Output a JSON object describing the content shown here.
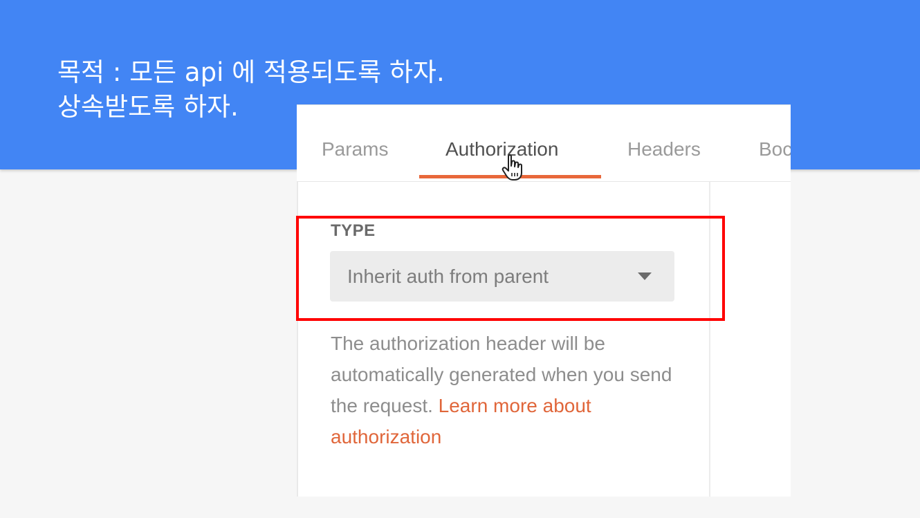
{
  "slide": {
    "title_line1": "목적 : 모든 api 에 적용되도록 하자.",
    "title_line2": "상속받도록 하자.",
    "banner_color": "#4285f4"
  },
  "tabs": [
    {
      "label": "Params",
      "active": false
    },
    {
      "label": "Authorization",
      "active": true
    },
    {
      "label": "Headers",
      "active": false
    },
    {
      "label": "Boc",
      "active": false
    }
  ],
  "auth": {
    "type_label": "TYPE",
    "selected_type": "Inherit auth from parent",
    "description": "The authorization header will be automatically generated when you send the request.",
    "learn_more_link": "Learn more about authorization"
  },
  "colors": {
    "accent": "#e8683a",
    "highlight": "#ff0000"
  },
  "icons": {
    "cursor": "hand-pointer-icon",
    "dropdown": "caret-down-icon"
  }
}
